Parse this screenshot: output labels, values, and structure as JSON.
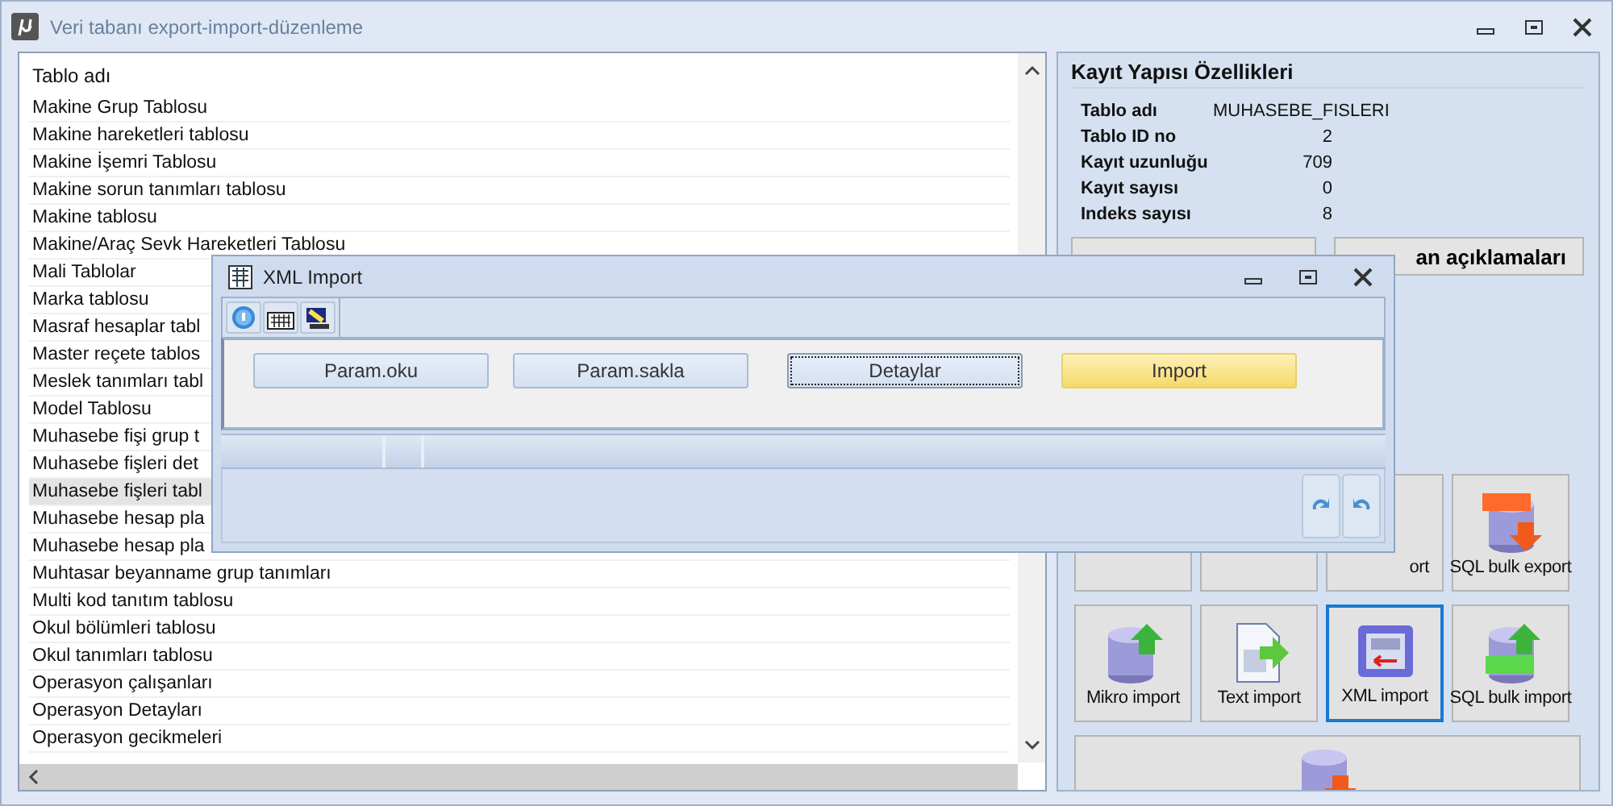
{
  "window": {
    "title": "Veri tabanı export-import-düzenleme"
  },
  "table": {
    "column": "Tablo adı",
    "rows": [
      {
        "name": "Makine Grup Tablosu",
        "selected": false
      },
      {
        "name": "Makine hareketleri tablosu",
        "selected": false
      },
      {
        "name": "Makine İşemri Tablosu",
        "selected": false
      },
      {
        "name": "Makine sorun tanımları tablosu",
        "selected": false
      },
      {
        "name": "Makine tablosu",
        "selected": false
      },
      {
        "name": "Makine/Araç Sevk Hareketleri Tablosu",
        "selected": false
      },
      {
        "name": "Mali Tablolar",
        "selected": false
      },
      {
        "name": "Marka tablosu",
        "selected": false
      },
      {
        "name": "Masraf hesaplar tabl",
        "selected": false
      },
      {
        "name": "Master reçete tablos",
        "selected": false
      },
      {
        "name": "Meslek tanımları tabl",
        "selected": false
      },
      {
        "name": "Model Tablosu",
        "selected": false
      },
      {
        "name": "Muhasebe fişi grup t",
        "selected": false
      },
      {
        "name": "Muhasebe fişleri det",
        "selected": false
      },
      {
        "name": "Muhasebe fişleri tabl",
        "selected": true
      },
      {
        "name": "Muhasebe hesap pla",
        "selected": false
      },
      {
        "name": "Muhasebe hesap pla",
        "selected": false
      },
      {
        "name": "Muhtasar beyanname grup tanımları",
        "selected": false
      },
      {
        "name": "Multi kod tanıtım tablosu",
        "selected": false
      },
      {
        "name": "Okul bölümleri tablosu",
        "selected": false
      },
      {
        "name": "Okul tanımları tablosu",
        "selected": false
      },
      {
        "name": "Operasyon çalışanları",
        "selected": false
      },
      {
        "name": "Operasyon Detayları",
        "selected": false
      },
      {
        "name": "Operasyon gecikmeleri",
        "selected": false
      }
    ]
  },
  "properties": {
    "title": "Kayıt Yapısı Özellikleri",
    "items": [
      {
        "label": "Tablo adı",
        "value": "MUHASEBE_FISLERI",
        "kind": "text"
      },
      {
        "label": "Tablo ID no",
        "value": "2",
        "kind": "number"
      },
      {
        "label": "Kayıt uzunluğu",
        "value": "709",
        "kind": "number"
      },
      {
        "label": "Kayıt sayısı",
        "value": "0",
        "kind": "number"
      },
      {
        "label": "Indeks sayısı",
        "value": "8",
        "kind": "number"
      }
    ],
    "buttons": [
      "an açıklamaları"
    ]
  },
  "tools": [
    {
      "kind": "hidden",
      "selected": false
    },
    {
      "kind": "hidden",
      "selected": false
    },
    {
      "kind": "cut",
      "label": "ort",
      "selected": false
    },
    {
      "kind": "sql-export",
      "label": "SQL bulk export",
      "selected": false
    },
    {
      "kind": "db-import",
      "label": "Mikro import",
      "selected": false
    },
    {
      "kind": "text-import",
      "label": "Text import",
      "selected": false
    },
    {
      "kind": "xml-import",
      "label": "XML import",
      "selected": true
    },
    {
      "kind": "sql-import",
      "label": "SQL bulk import",
      "selected": false
    },
    {
      "kind": "db-export",
      "selected": false
    }
  ],
  "dialog": {
    "title": "XML Import",
    "buttons": [
      {
        "label": "Param.oku",
        "focused": false,
        "default": false
      },
      {
        "label": "Param.sakla",
        "focused": false,
        "default": false
      },
      {
        "label": "Detaylar",
        "focused": true,
        "default": false
      },
      {
        "label": "Import",
        "focused": false,
        "default": true
      }
    ]
  }
}
